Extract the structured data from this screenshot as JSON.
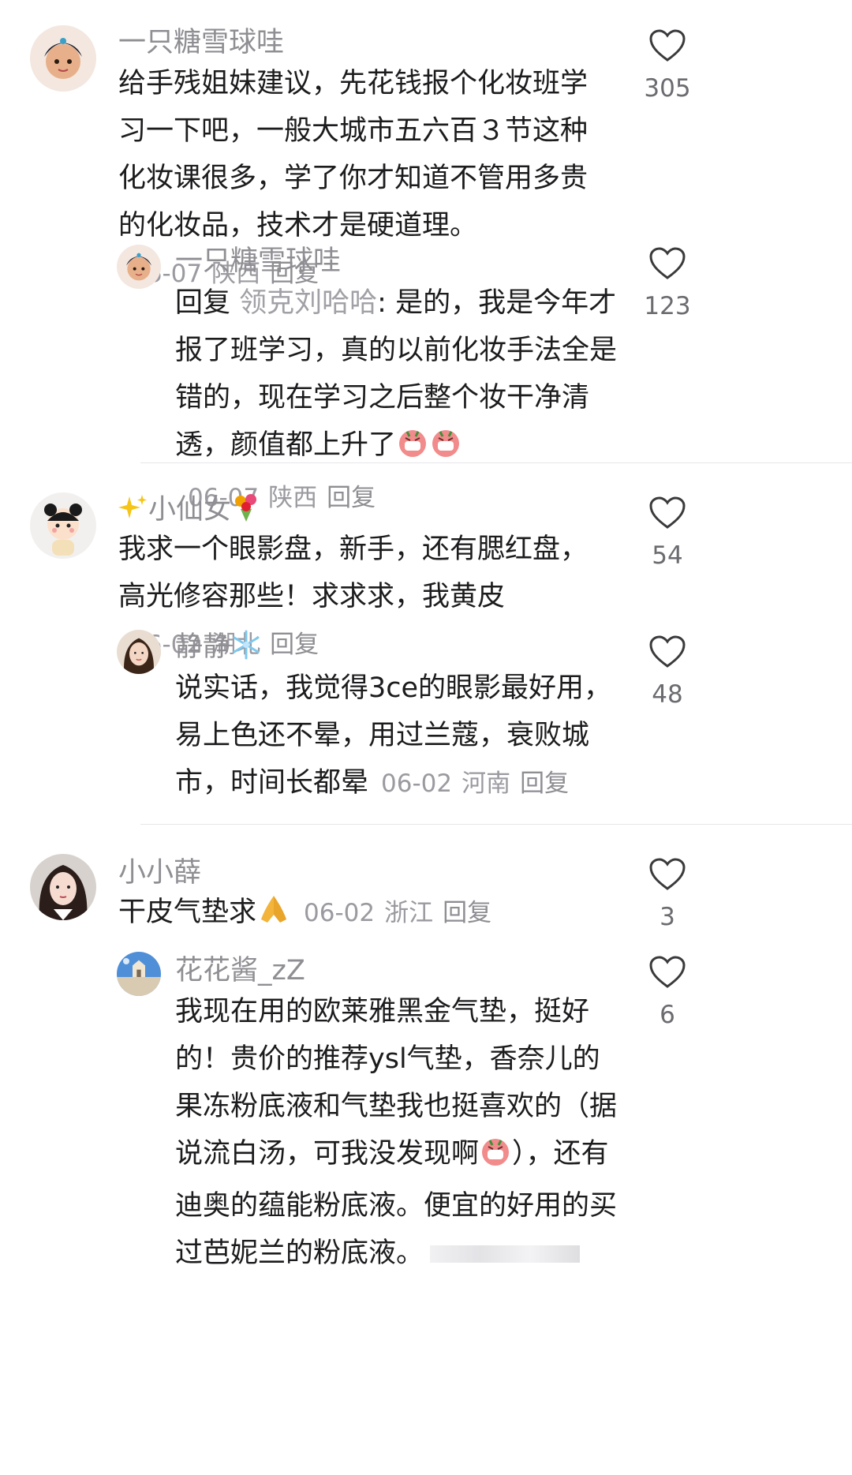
{
  "comments": [
    {
      "username": "一只糖雪球哇",
      "text": "给手残姐妹建议，先花钱报个化妆班学习一下吧，一般大城市五六百３节这种化妆课很多，学了你才知道不管用多贵的化妆品，技术才是硬道理。",
      "date": "06-07",
      "location": "陕西",
      "reply_label": "回复",
      "likes": "305",
      "replies": [
        {
          "username": "一只糖雪球哇",
          "reply_prefix": "回复",
          "mention": "领克刘哈哈",
          "text": ": 是的，我是今年才报了班学习，真的以前化妆手法全是错的，现在学习之后整个妆干净清透，颜值都上升了",
          "date": "06-07",
          "location": "陕西",
          "reply_label": "回复",
          "likes": "123"
        }
      ]
    },
    {
      "username": "小仙女",
      "text": "我求一个眼影盘，新手，还有腮红盘，高光修容那些！求求求，我黄皮",
      "date": "06-02",
      "location": "湖北",
      "reply_label": "回复",
      "likes": "54",
      "replies": [
        {
          "username": "静静",
          "text": "说实话，我觉得3ce的眼影最好用，易上色还不晕，用过兰蔻，衰败城市，时间长都晕",
          "date": "06-02",
          "location": "河南",
          "reply_label": "回复",
          "likes": "48"
        }
      ]
    },
    {
      "username": "小小薛",
      "text": "干皮气垫求",
      "date": "06-02",
      "location": "浙江",
      "reply_label": "回复",
      "likes": "3",
      "replies": [
        {
          "username": "花花酱_zZ",
          "text": "我现在用的欧莱雅黑金气垫，挺好的！贵价的推荐ysl气垫，香奈儿的果冻粉底液和气垫我也挺喜欢的（据说流白汤，可我没发现啊",
          "text_after_emoji": "），还有迪奥的蕴能粉底液。便宜的好用的买过芭妮兰的粉底液。",
          "likes": "6"
        }
      ]
    }
  ],
  "icons": {
    "like": "heart-outline-icon",
    "emoji_cry": "crying-face-emoji",
    "emoji_sparkles": "sparkles-emoji",
    "emoji_bouquet": "bouquet-emoji",
    "emoji_snowflake": "snowflake-emoji",
    "emoji_pray": "folded-hands-emoji"
  },
  "colors": {
    "text": "#1c1c1e",
    "username": "#8e8e93",
    "meta": "#9a9aa0",
    "divider": "#e6e6ea"
  }
}
